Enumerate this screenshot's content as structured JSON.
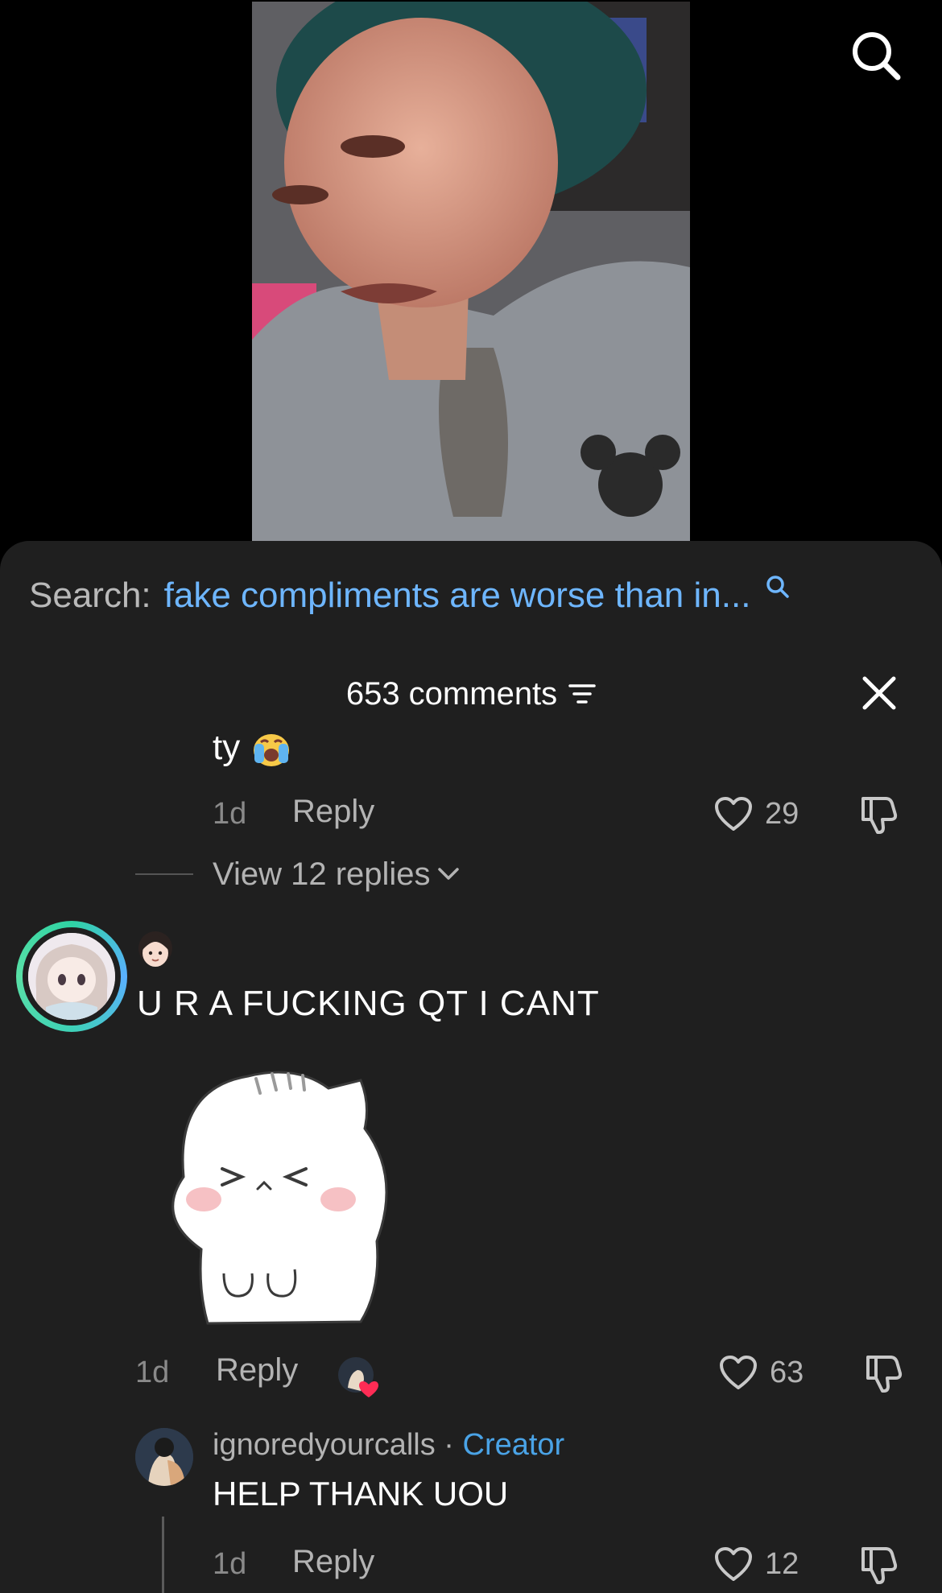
{
  "search": {
    "label": "Search:",
    "query": "fake compliments are worse than in..."
  },
  "comments": {
    "count_label": "653 comments",
    "partial_comment": {
      "text": "ty",
      "emoji": "loudly-crying-face-emoji",
      "time": "1d",
      "reply_label": "Reply",
      "likes": "29",
      "view_replies": "View 12 replies"
    },
    "main_comment": {
      "username_emoji": "girl-face-emoji",
      "text": "U R A FUCKING QT I CANT",
      "sticker": "white-cat-sticker",
      "time": "1d",
      "reply_label": "Reply",
      "likes": "63"
    },
    "creator_reply": {
      "username": "ignoredyourcalls",
      "separator": " · ",
      "badge": "Creator",
      "text": "HELP THANK UOU",
      "time": "1d",
      "reply_label": "Reply",
      "likes": "12"
    }
  },
  "colors": {
    "sheet_bg": "#1f1f1f",
    "query_blue": "#6eb6ff",
    "creator_blue": "#4aa3e6",
    "muted": "#8a8a8a",
    "like_heart_red": "#fe2c55"
  }
}
